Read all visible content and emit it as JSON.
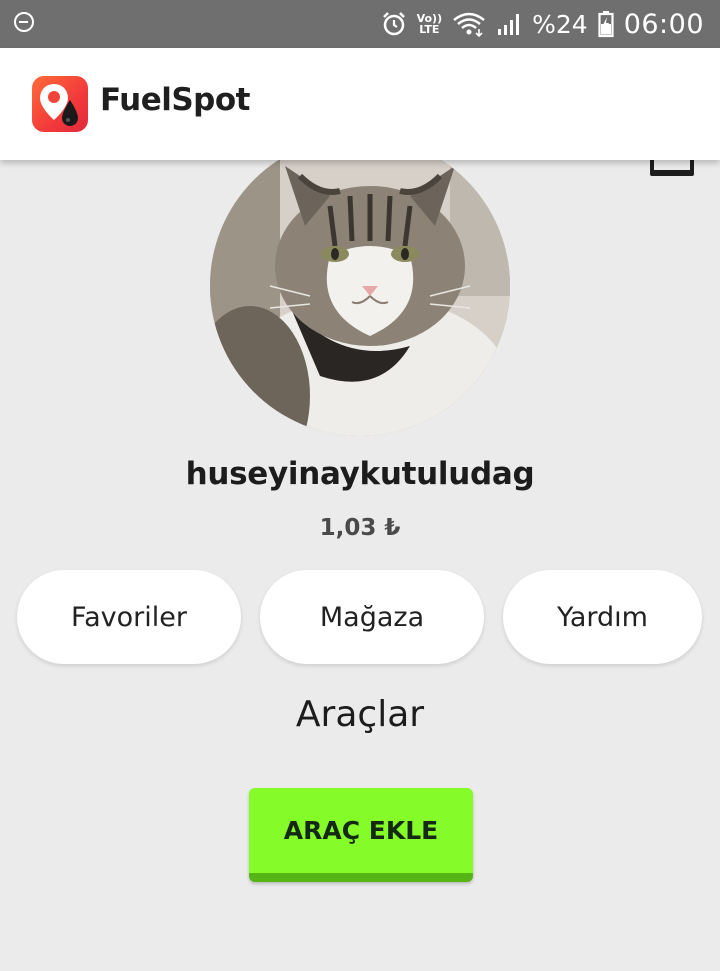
{
  "status_bar": {
    "battery_percent": "%24",
    "time": "06:00",
    "volte_label_top": "Vo))",
    "volte_label_bottom": "LTE",
    "icons": [
      "dnd-icon",
      "alarm-icon",
      "volte-icon",
      "wifi-icon",
      "signal-icon",
      "battery-icon"
    ]
  },
  "app_bar": {
    "title": "FuelSpot",
    "logo_icon": "fuelspot-logo-icon",
    "brand_gradient": [
      "#ff6b3a",
      "#e02a3e"
    ]
  },
  "profile": {
    "username": "huseyinaykutuludag",
    "balance": "1,03 ₺",
    "avatar_description_icon": "cat-avatar"
  },
  "actions": {
    "favorites_label": "Favoriler",
    "store_label": "Mağaza",
    "help_label": "Yardım"
  },
  "vehicles": {
    "section_title": "Araçlar",
    "add_button_label": "ARAÇ EKLE",
    "add_button_color": "#85fb2a"
  },
  "colors": {
    "background": "#ebebeb",
    "status_bar": "#6f6f6f",
    "app_bar": "#ffffff"
  }
}
